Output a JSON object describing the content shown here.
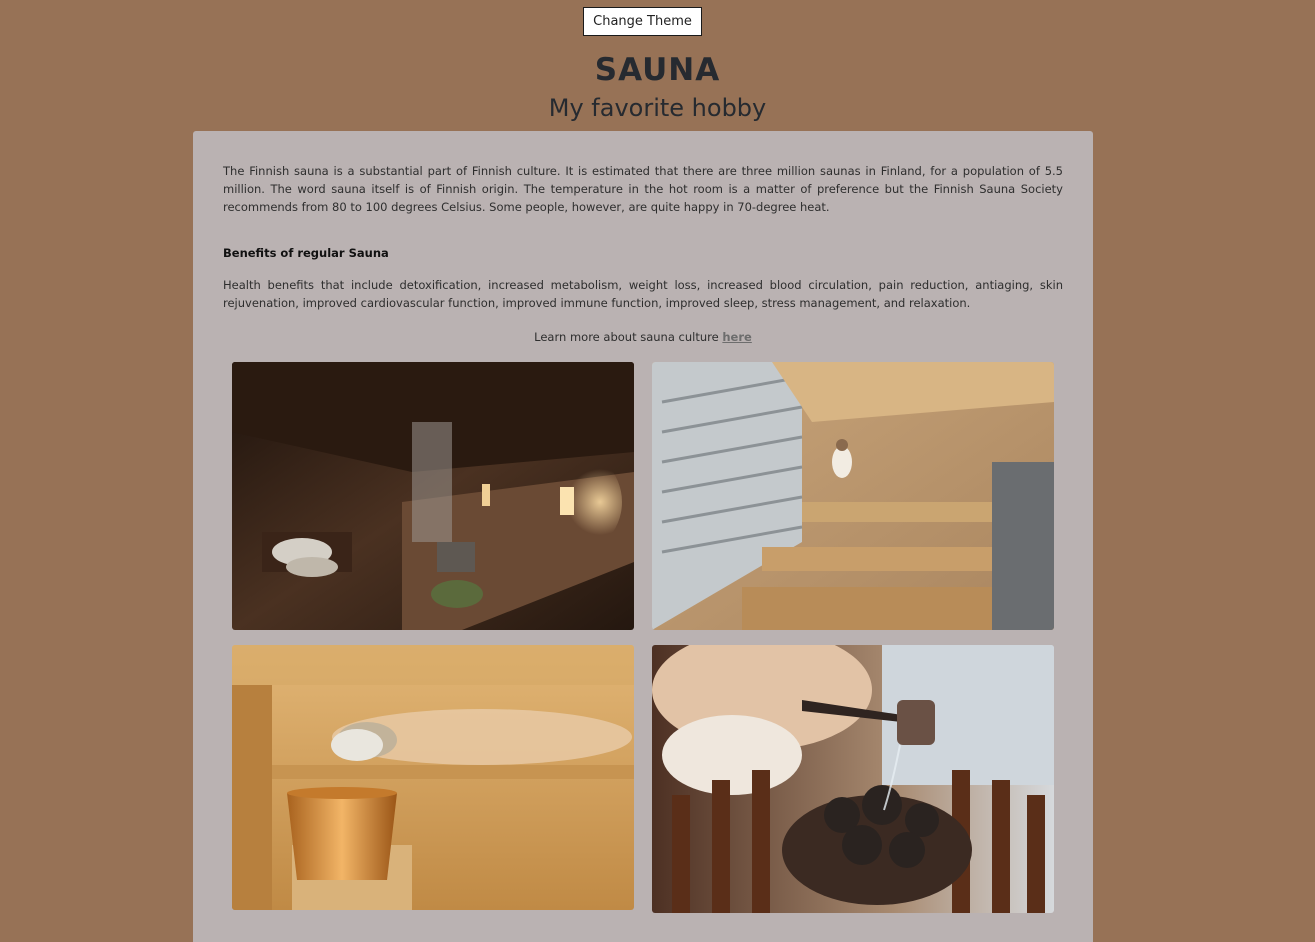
{
  "theme_button": {
    "label": "Change Theme"
  },
  "header": {
    "title": "SAUNA",
    "subtitle": "My favorite hobby"
  },
  "content": {
    "intro": "The Finnish sauna is a substantial part of Finnish culture. It is estimated that there are three million saunas in Finland, for a population of 5.5 million. The word sauna itself is of Finnish origin. The temperature in the hot room is a matter of preference but the Finnish Sauna Society recommends from 80 to 100 degrees Celsius. Some people, however, are quite happy in 70-degree heat.",
    "benefits_heading": "Benefits of regular Sauna",
    "benefits_text": "Health benefits that include detoxification, increased metabolism, weight loss, increased blood circulation, pain reduction, antiaging, skin rejuvenation, improved cardiovascular function, improved immune function, improved sleep, stress management, and relaxation.",
    "learn_more_prefix": "Learn more about sauna culture ",
    "learn_more_link": "here"
  },
  "colors": {
    "background": "#977256",
    "card": "#bab2b2",
    "heading": "#262a30",
    "link": "#6d6d6d"
  }
}
